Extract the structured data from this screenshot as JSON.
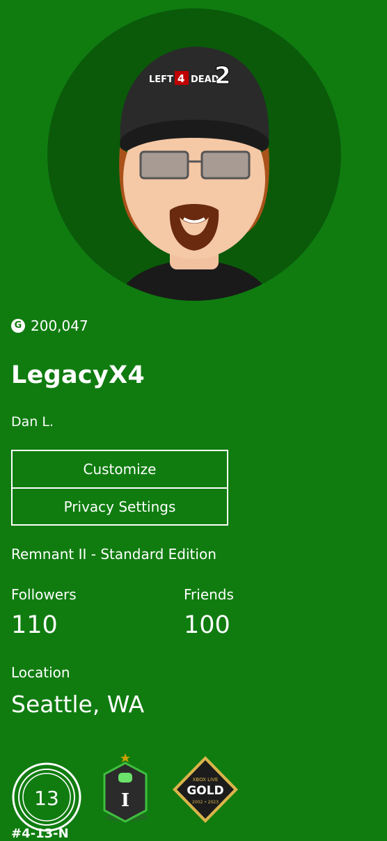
{
  "profile": {
    "gamerscore": "200,047",
    "gamerscore_icon": "gamerscore-g-icon",
    "gamertag": "LegacyX4",
    "real_name": "Dan L.",
    "now_playing": "Remnant II - Standard Edition"
  },
  "avatar": {
    "cap_text_left": "LEFT",
    "cap_text_num": "4",
    "cap_text_right": "DEAD",
    "cap_text_logo": "2"
  },
  "actions": {
    "customize_label": "Customize",
    "privacy_label": "Privacy Settings"
  },
  "stats": {
    "followers_label": "Followers",
    "followers_value": "110",
    "friends_label": "Friends",
    "friends_value": "100",
    "location_label": "Location",
    "location_value": "Seattle, WA"
  },
  "badges": {
    "tenure_value": "13",
    "rank_letter": "I",
    "gold_top": "XBOX LIVE",
    "gold_main": "GOLD",
    "gold_years": "2002 • 2023"
  },
  "partial": {
    "text": "#4-13-N"
  },
  "colors": {
    "background": "#107c10",
    "avatar_circle": "#0a5a0a",
    "text": "#ffffff"
  }
}
